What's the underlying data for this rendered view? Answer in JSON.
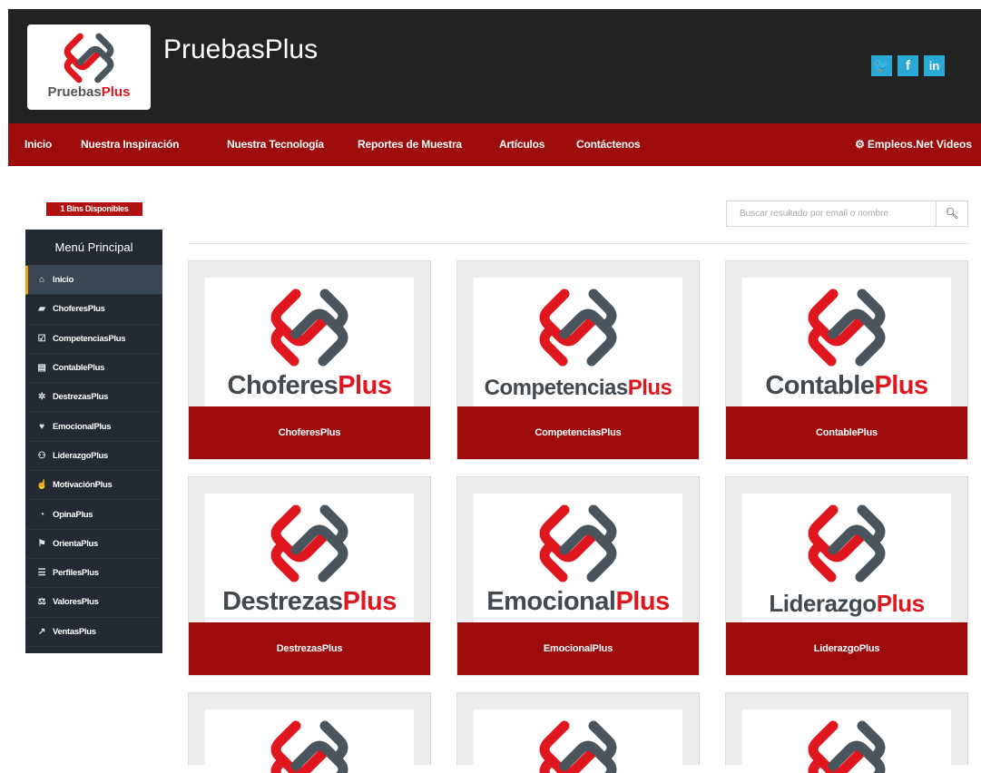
{
  "header": {
    "logo_name": "Pruebas",
    "logo_plus": "Plus",
    "site_title": "PruebasPlus",
    "social": {
      "twitter": "🐦",
      "facebook": "f",
      "linkedin": "in"
    }
  },
  "nav": {
    "items": [
      "Inicio",
      "Nuestra Inspiración",
      "Nuestra Tecnología",
      "Reportes de Muestra",
      "Artículos",
      "Contáctenos"
    ],
    "right": "Empleos.Net Videos"
  },
  "sidebar": {
    "badge": "1 Bins Disponibles",
    "title": "Menú Principal",
    "items": [
      {
        "label": "Inicio",
        "icon": "home-icon"
      },
      {
        "label": "ChoferesPlus",
        "icon": "car-icon"
      },
      {
        "label": "CompetenciasPlus",
        "icon": "checkbox-icon"
      },
      {
        "label": "ContablePlus",
        "icon": "calculator-icon"
      },
      {
        "label": "DestrezasPlus",
        "icon": "gears-icon"
      },
      {
        "label": "EmocionalPlus",
        "icon": "heartbeat-icon"
      },
      {
        "label": "LiderazgoPlus",
        "icon": "users-icon"
      },
      {
        "label": "MotivaciónPlus",
        "icon": "thumbs-up-icon"
      },
      {
        "label": "OpinaPlus",
        "icon": "comments-icon"
      },
      {
        "label": "OrientaPlus",
        "icon": "signpost-icon"
      },
      {
        "label": "PerfilesPlus",
        "icon": "list-icon"
      },
      {
        "label": "ValoresPlus",
        "icon": "balance-icon"
      },
      {
        "label": "VentasPlus",
        "icon": "line-chart-icon"
      }
    ]
  },
  "search": {
    "placeholder": "Buscar resultado por email o nombre"
  },
  "cards": [
    {
      "name": "Choferes",
      "plus": "Plus",
      "label": "ChoferesPlus"
    },
    {
      "name": "Competencias",
      "plus": "Plus",
      "label": "CompetenciasPlus"
    },
    {
      "name": "Contable",
      "plus": "Plus",
      "label": "ContablePlus"
    },
    {
      "name": "Destrezas",
      "plus": "Plus",
      "label": "DestrezasPlus"
    },
    {
      "name": "Emocional",
      "plus": "Plus",
      "label": "EmocionalPlus"
    },
    {
      "name": "Liderazgo",
      "plus": "Plus",
      "label": "LiderazgoPlus"
    }
  ],
  "colors": {
    "header_bg": "#222222",
    "nav_bg": "#9e0b0b",
    "accent_red": "#e0161e",
    "sidebar_bg": "#232a31",
    "active_marker": "#e8a20b"
  }
}
